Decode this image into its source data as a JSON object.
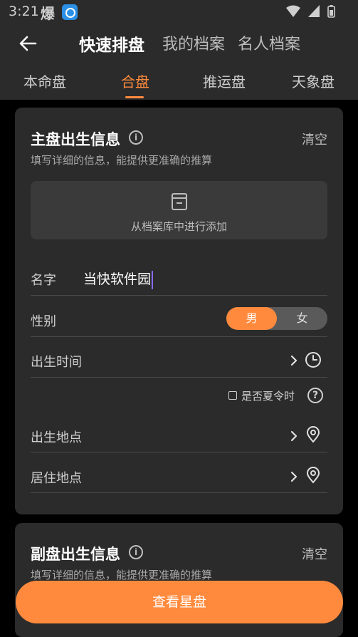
{
  "status_bar": {
    "time": "3:21",
    "badge": "爆"
  },
  "nav": {
    "tabs": [
      {
        "label": "快速排盘",
        "active": true
      },
      {
        "label": "我的档案",
        "active": false
      },
      {
        "label": "名人档案",
        "active": false
      }
    ]
  },
  "sub_tabs": [
    {
      "label": "本命盘",
      "active": false
    },
    {
      "label": "合盘",
      "active": true
    },
    {
      "label": "推运盘",
      "active": false
    },
    {
      "label": "天象盘",
      "active": false
    }
  ],
  "primary": {
    "title": "主盘出生信息",
    "clear_label": "清空",
    "description": "填写详细的信息，能提供更准确的推算",
    "add_from_archive": "从档案库中进行添加",
    "name_label": "名字",
    "name_value": "当快软件园",
    "gender_label": "性别",
    "gender_male": "男",
    "gender_female": "女",
    "gender_selected": "男",
    "birth_time_label": "出生时间",
    "dst_label": "是否夏令时",
    "dst_checked": false,
    "birth_place_label": "出生地点",
    "residence_label": "居住地点"
  },
  "secondary": {
    "title": "副盘出生信息",
    "clear_label": "清空",
    "description": "填写详细的信息，能提供更准确的推算"
  },
  "cta": {
    "label": "查看星盘"
  },
  "colors": {
    "accent": "#ff8a3d",
    "card_bg": "#2b2b2b",
    "page_bg": "#000000"
  }
}
